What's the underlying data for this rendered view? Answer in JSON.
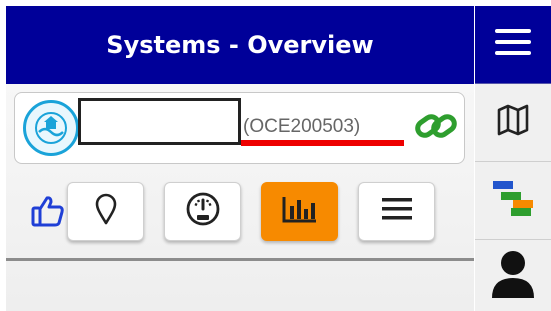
{
  "header": {
    "title": "Systems - Overview"
  },
  "system": {
    "id": "(OCE200503)",
    "name_value": ""
  },
  "actions": {
    "buttons": [
      {
        "icon": "location-pin-icon"
      },
      {
        "icon": "gauge-icon"
      },
      {
        "icon": "bar-chart-icon",
        "active": true
      },
      {
        "icon": "menu-icon"
      }
    ]
  },
  "sidebar": {
    "items": [
      {
        "icon": "hamburger-icon",
        "active": true
      },
      {
        "icon": "map-icon"
      },
      {
        "icon": "hierarchy-icon"
      },
      {
        "icon": "user-icon"
      }
    ]
  },
  "colors": {
    "header_bg": "#000099",
    "accent_orange": "#f78a00",
    "link_green": "#2e9e2e",
    "underline_red": "#ee0000",
    "like_blue": "#1f3fd6"
  }
}
